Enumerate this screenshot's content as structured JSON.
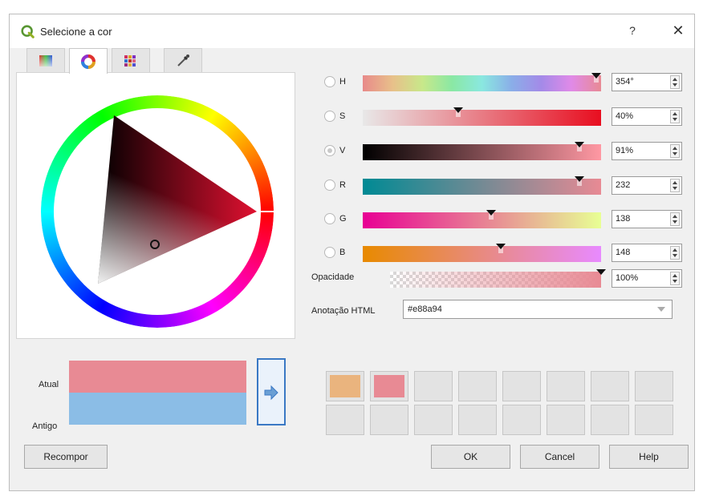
{
  "window": {
    "title": "Selecione a cor",
    "help_glyph": "?",
    "close_glyph": "✕"
  },
  "tabs": [
    {
      "name": "ramp-tab-icon",
      "active": false
    },
    {
      "name": "wheel-tab-icon",
      "active": true
    },
    {
      "name": "swatches-tab-icon",
      "active": false
    },
    {
      "name": "picker-tab-icon",
      "active": false
    }
  ],
  "channels": [
    {
      "key": "H",
      "label": "H",
      "value": "354°",
      "checked": false,
      "handle": 0.98
    },
    {
      "key": "S",
      "label": "S",
      "value": "40%",
      "checked": false,
      "handle": 0.4
    },
    {
      "key": "V",
      "label": "V",
      "value": "91%",
      "checked": true,
      "handle": 0.91
    },
    {
      "key": "R",
      "label": "R",
      "value": "232",
      "checked": false,
      "handle": 0.91
    },
    {
      "key": "G",
      "label": "G",
      "value": "138",
      "checked": false,
      "handle": 0.54
    },
    {
      "key": "B",
      "label": "B",
      "value": "148",
      "checked": false,
      "handle": 0.58
    }
  ],
  "opacity": {
    "label": "Opacidade",
    "value": "100%",
    "handle": 1.0
  },
  "html_notation": {
    "label": "Anotação HTML",
    "value": "#e88a94"
  },
  "compare": {
    "current_label": "Atual",
    "old_label": "Antigo",
    "current_color": "#e88a94",
    "old_color": "#8bbde6"
  },
  "swatch_grid": {
    "filled": [
      "#eab47e",
      "#e88a94"
    ],
    "empty_cells": 14
  },
  "buttons": {
    "reset": "Recompor",
    "ok": "OK",
    "cancel": "Cancel",
    "help": "Help"
  },
  "colors": {
    "accent": "#3a78c4",
    "selected": "#e88a94",
    "previous": "#8bbde6"
  }
}
